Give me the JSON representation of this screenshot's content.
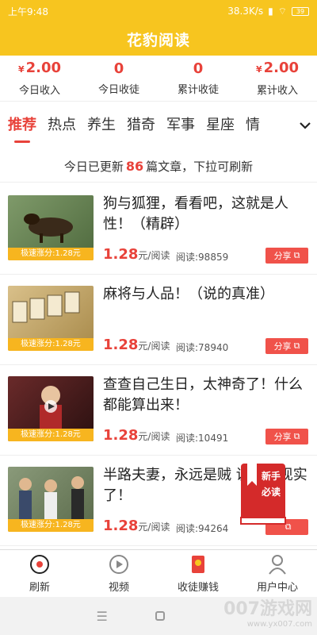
{
  "status": {
    "time": "上午9:48",
    "speed": "38.3K/s",
    "battery": "39"
  },
  "header": {
    "title": "花豹阅读"
  },
  "stats": [
    {
      "value": "2.00",
      "currency": "¥",
      "label": "今日收入"
    },
    {
      "value": "0",
      "currency": "",
      "label": "今日收徒"
    },
    {
      "value": "0",
      "currency": "",
      "label": "累计收徒"
    },
    {
      "value": "2.00",
      "currency": "¥",
      "label": "累计收入"
    }
  ],
  "tabs": [
    "推荐",
    "热点",
    "养生",
    "猎奇",
    "军事",
    "星座",
    "情"
  ],
  "notice": {
    "prefix": "今日已更新",
    "count": "86",
    "suffix": "篇文章，下拉可刷新"
  },
  "articles": [
    {
      "title": "狗与狐狸，看看吧，这就是人性！（精辟）",
      "tag": "极速涨分:1.28元",
      "price": "1.28",
      "unit": "元/阅读",
      "reads": "阅读:98859",
      "share": "分享",
      "thumb_color": "#6b8a5a"
    },
    {
      "title": "麻将与人品！（说的真准）",
      "tag": "极速涨分:1.28元",
      "price": "1.28",
      "unit": "元/阅读",
      "reads": "阅读:78940",
      "share": "分享",
      "thumb_color": "#c9a86a"
    },
    {
      "title": "查查自己生日，太神奇了！什么都能算出来！",
      "tag": "极速涨分:1.28元",
      "price": "1.28",
      "unit": "元/阅读",
      "reads": "阅读:10491",
      "share": "分享",
      "thumb_color": "#8a3a3a"
    },
    {
      "title": "半路夫妻，永远是贼 说的太现实了！",
      "tag": "极速涨分:1.28元",
      "price": "1.28",
      "unit": "元/阅读",
      "reads": "阅读:94264",
      "share": "",
      "thumb_color": "#7a8a6a"
    }
  ],
  "badge": {
    "line1": "新手",
    "line2": "必读"
  },
  "nav": [
    {
      "label": "刷新",
      "icon": "refresh-icon"
    },
    {
      "label": "视频",
      "icon": "play-icon"
    },
    {
      "label": "收徒赚钱",
      "icon": "redpacket-icon"
    },
    {
      "label": "用户中心",
      "icon": "user-icon"
    }
  ],
  "watermark": {
    "main": "007游戏网",
    "sub": "www.yx007.com"
  },
  "colors": {
    "brand": "#f7c51f",
    "accent": "#e8423a"
  }
}
